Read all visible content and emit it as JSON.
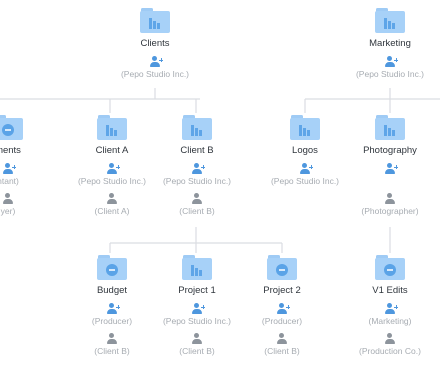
{
  "nodes": [
    {
      "id": "clients",
      "label": "Clients",
      "folder": "docs",
      "owner": "(Pepo Studio Inc.)",
      "member": ""
    },
    {
      "id": "marketing",
      "label": "Marketing",
      "folder": "docs",
      "owner": "(Pepo Studio Inc.)",
      "member": ""
    },
    {
      "id": "agreements",
      "label": "ments",
      "folder": "badge",
      "owner": "ntant)",
      "member": "yer)"
    },
    {
      "id": "client-a",
      "label": "Client A",
      "folder": "docs",
      "owner": "(Pepo Studio Inc.)",
      "member": "(Client A)"
    },
    {
      "id": "client-b",
      "label": "Client B",
      "folder": "docs",
      "owner": "(Pepo Studio Inc.)",
      "member": "(Client B)"
    },
    {
      "id": "logos",
      "label": "Logos",
      "folder": "docs",
      "owner": "(Pepo Studio Inc.)",
      "member": ""
    },
    {
      "id": "photography",
      "label": "Photography",
      "folder": "docs",
      "owner": "",
      "member": "(Photographer)"
    },
    {
      "id": "budget",
      "label": "Budget",
      "folder": "badge",
      "owner": "(Producer)",
      "member": "(Client B)"
    },
    {
      "id": "project-1",
      "label": "Project 1",
      "folder": "docs",
      "owner": "(Pepo Studio Inc.)",
      "member": "(Client B)"
    },
    {
      "id": "project-2",
      "label": "Project 2",
      "folder": "badge",
      "owner": "(Producer)",
      "member": "(Client B)"
    },
    {
      "id": "v1-edits",
      "label": "V1 Edits",
      "folder": "badge",
      "owner": "(Marketing)",
      "member": "(Production Co.)"
    }
  ],
  "colors": {
    "folder": "#a7d1f8",
    "folder_mark": "#5ea5e8",
    "owner_icon": "#4e97de",
    "member_icon": "#8d949c",
    "connector": "#dadde2",
    "label_text": "#30363d",
    "role_text": "#a7acb2"
  }
}
